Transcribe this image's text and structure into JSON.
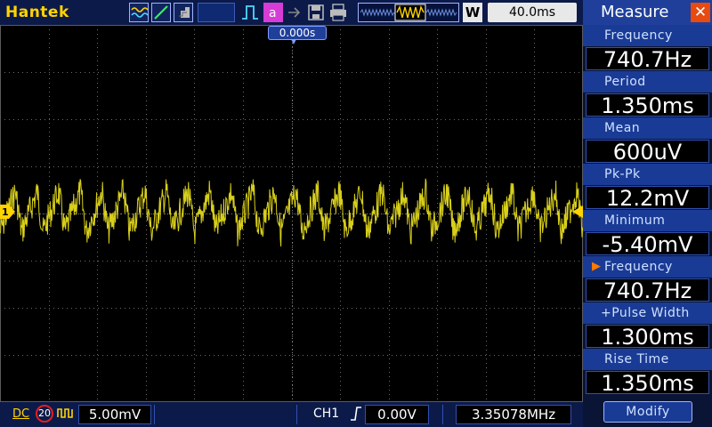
{
  "header": {
    "brand": "Hantek",
    "timebase": "40.0ms",
    "window_button": "W",
    "trigger_position": "0.000s",
    "icons": [
      "waveform-icon",
      "cursor-icon",
      "persist-icon",
      "trigger-pulse-icon",
      "math-icon",
      "save-icon",
      "print-icon",
      "memory-waveform-icon"
    ]
  },
  "measure_panel": {
    "title": "Measure",
    "items": [
      {
        "label": "Frequency",
        "value": "740.7Hz",
        "selected": false
      },
      {
        "label": "Period",
        "value": "1.350ms",
        "selected": false
      },
      {
        "label": "Mean",
        "value": "600uV",
        "selected": false
      },
      {
        "label": "Pk-Pk",
        "value": "12.2mV",
        "selected": false
      },
      {
        "label": "Minimum",
        "value": "-5.40mV",
        "selected": false
      },
      {
        "label": "Frequency",
        "value": "740.7Hz",
        "selected": true
      },
      {
        "label": "+Pulse Width",
        "value": "1.300ms",
        "selected": false
      },
      {
        "label": "Rise Time",
        "value": "1.350ms",
        "selected": false
      }
    ],
    "modify_label": "Modify"
  },
  "footer": {
    "coupling": "DC",
    "bandwidth_limit": "20",
    "volts_per_div": "5.00mV",
    "trigger_channel": "CH1",
    "trigger_level": "0.00V",
    "frequency_counter": "3.35078MHz"
  },
  "waveform": {
    "channel": "1",
    "color": "#d8cf1a",
    "frequency_hz": 740.7,
    "pk_pk_mv": 12.2
  },
  "colors": {
    "accent": "#ffd400",
    "panel_label": "#1a3b95",
    "close": "#e84a10",
    "grid": "#6a6a6a"
  }
}
